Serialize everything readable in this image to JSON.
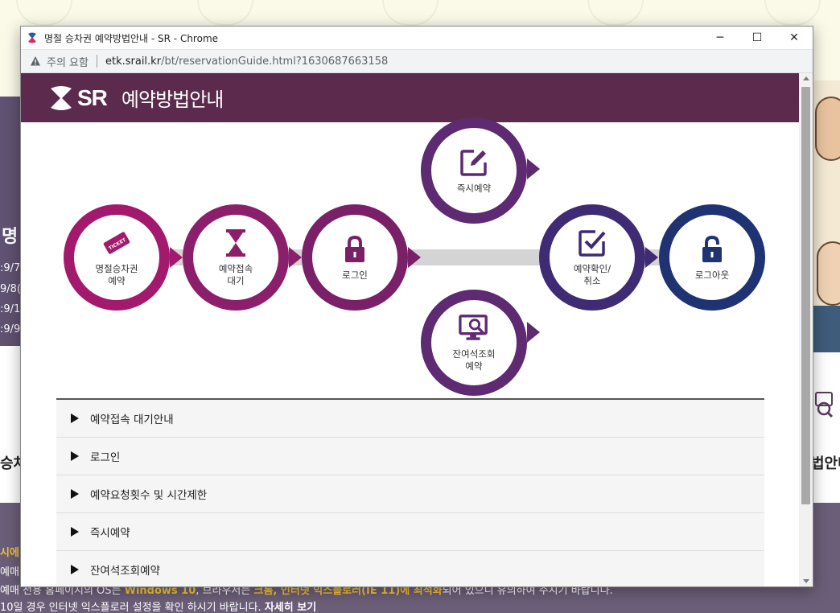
{
  "background": {
    "left_title": "명",
    "left_dates": [
      ":9/7(",
      " 9/8(",
      ":9/17",
      ":9/9("
    ],
    "left_heading": "승차",
    "right_heading": "법안내",
    "notices": [
      {
        "prefix": "시에",
        "text": ""
      },
      {
        "prefix": "예매",
        "text": ""
      },
      {
        "prefix": "예매 전용 홈페이지의 OS는 ",
        "hl": "Windows 10",
        "text": ", 브라우저는 ",
        "hl2": "크롬, 인터넷 익스플로러(IE 11)에 최적화",
        "text2": "되어 있으니 유의하여 주시기 바랍니다."
      },
      {
        "prefix": "10일 경우 인터넷 익스플로러 설정을 확인 하시기 바랍니다. ",
        "link": "자세히 보기"
      }
    ]
  },
  "window": {
    "title": "명절 승차권 예약방법안내 - SR - Chrome",
    "controls": {
      "minimize": "─",
      "maximize": "☐",
      "close": "✕"
    }
  },
  "addressbar": {
    "warning": "주의 요함",
    "url_host": "etk.srail.kr",
    "url_path": "/bt/reservationGuide.html?1630687663158"
  },
  "header": {
    "logo": "SR",
    "title": "예약방법안내"
  },
  "steps": [
    {
      "label": "명절승차권\n예약",
      "icon": "ticket-icon",
      "color": "#a3196d"
    },
    {
      "label": "예약접속\n대기",
      "icon": "hourglass-icon",
      "color": "#8c1f6c"
    },
    {
      "label": "로그인",
      "icon": "lock-icon",
      "color": "#7a2068"
    },
    {
      "label": "즉시예약",
      "icon": "edit-icon",
      "color": "#5e2a72"
    },
    {
      "label": "잔여석조회\n예약",
      "icon": "monitor-search-icon",
      "color": "#5e2a72"
    },
    {
      "label": "예약확인/\n취소",
      "icon": "checkbox-icon",
      "color": "#3f2a74"
    },
    {
      "label": "로그아웃",
      "icon": "unlock-icon",
      "color": "#1f3373"
    }
  ],
  "accordion": [
    {
      "label": "예약접속 대기안내"
    },
    {
      "label": "로그인"
    },
    {
      "label": "예약요청횟수 및 시간제한"
    },
    {
      "label": "즉시예약"
    },
    {
      "label": "잔여석조회예약"
    }
  ]
}
